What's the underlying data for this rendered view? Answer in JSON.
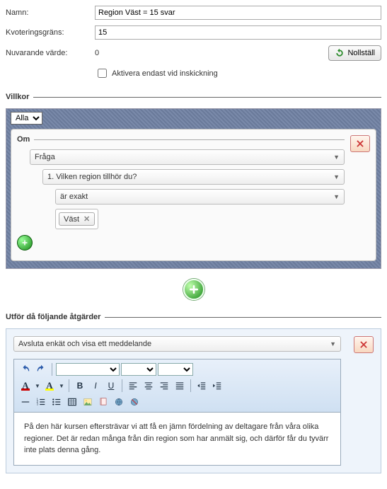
{
  "form": {
    "name_label": "Namn:",
    "name_value": "Region Väst = 15 svar",
    "quota_label": "Kvoteringsgräns:",
    "quota_value": "15",
    "current_label": "Nuvarande värde:",
    "current_value": "0",
    "reset_label": "Nollställ",
    "activate_label": "Aktivera endast vid inskickning"
  },
  "conditions": {
    "legend": "Villkor",
    "mode": "Alla",
    "group_label": "Om",
    "type": "Fråga",
    "question": "1. Vilken region tillhör du?",
    "operator": "är exakt",
    "value": "Väst"
  },
  "actions": {
    "legend": "Utför då följande åtgärder",
    "action_type": "Avsluta enkät och visa ett meddelande",
    "message": "På den här kursen eftersträvar vi att få en jämn fördelning av deltagare från våra olika regioner. Det är redan många från din region som har anmält sig, och därför får du tyvärr inte plats denna gång."
  }
}
